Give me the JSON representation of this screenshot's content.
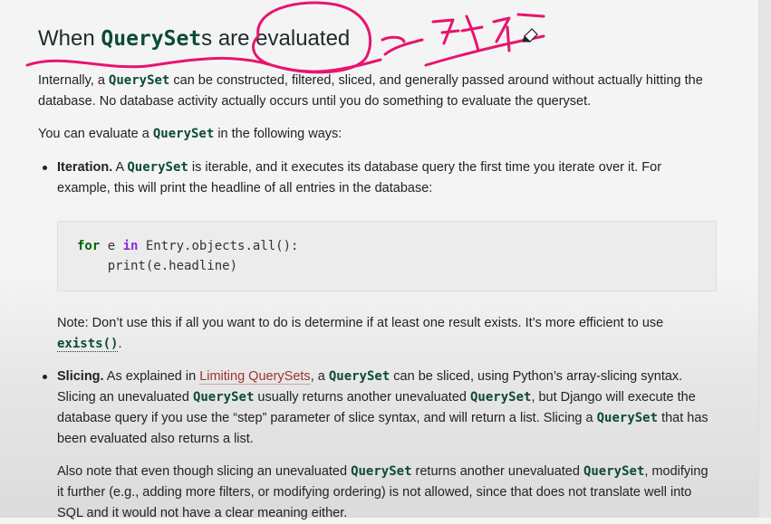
{
  "heading": {
    "code": "QuerySet",
    "text_after_code": "s are evaluated"
  },
  "paragraph1": {
    "t1": "Internally, a ",
    "code": "QuerySet",
    "t2": " can be constructed, filtered, sliced, and generally passed around without actually hitting the database. No database activity actually occurs until you do something to evaluate the queryset."
  },
  "paragraph2": {
    "t1": "You can evaluate a ",
    "code": "QuerySet",
    "t2": " in the following ways:"
  },
  "iteration": {
    "label": "Iteration.",
    "t1": " A ",
    "code": "QuerySet",
    "t2": " is iterable, and it executes its database query the first time you iterate over it. For example, this will print the headline of all entries in the database:"
  },
  "code_block": {
    "line1_kw_for": "for",
    "line1_var": " e ",
    "line1_kw_in": "in",
    "line1_rest": " Entry.objects.all():",
    "line2": "    print(e.headline)"
  },
  "note": {
    "t1": "Note: Don’t use this if all you want to do is determine if at least one result exists. It’s more efficient to use ",
    "code": "exists()",
    "t2": "."
  },
  "slicing": {
    "label": "Slicing.",
    "t1": " As explained in ",
    "link": "Limiting QuerySets",
    "t2": ", a ",
    "code1": "QuerySet",
    "t3": " can be sliced, using Python’s array-slicing syntax. Slicing an unevaluated ",
    "code2": "QuerySet",
    "t4": " usually returns another unevaluated ",
    "code3": "QuerySet",
    "t5": ", but Django will execute the database query if you use the “step” parameter of slice syntax, and will return a list. Slicing a ",
    "code4": "QuerySet",
    "t6": " that has been evaluated also returns a list."
  },
  "slicing_p2": {
    "t1": "Also note that even though slicing an unevaluated ",
    "code1": "QuerySet",
    "t2": " returns another unevaluated ",
    "code2": "QuerySet",
    "t3": ", modifying it further (e.g., adding more filters, or modifying ordering) is not allowed, since that does not translate well into SQL and it would not have a clear meaning either."
  },
  "colors": {
    "annotation_ink": "#e8146e",
    "code_accent": "#0c4b33",
    "link": "#a0332b"
  },
  "icons": {
    "cursor": "pen-cursor-icon"
  }
}
